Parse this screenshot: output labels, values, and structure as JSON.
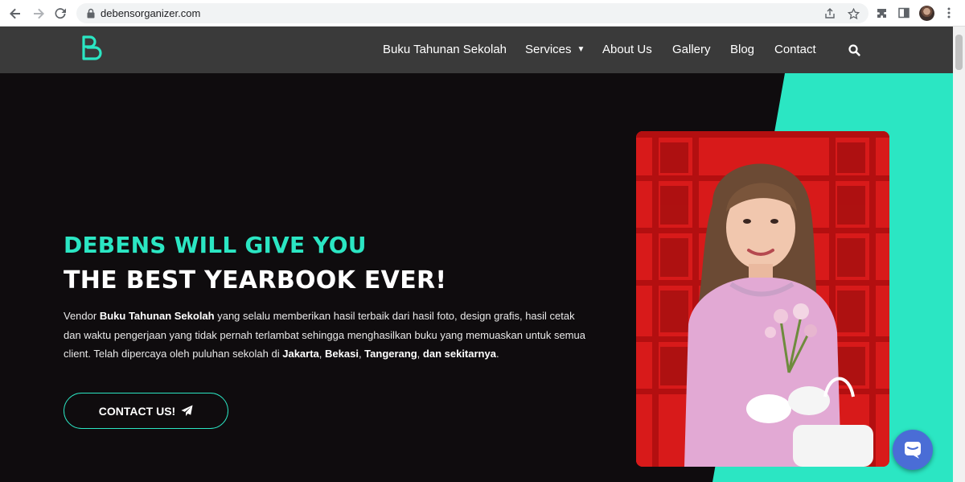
{
  "browser": {
    "url": "debensorganizer.com"
  },
  "header": {
    "nav": [
      {
        "label": "Buku Tahunan Sekolah"
      },
      {
        "label": "Services"
      },
      {
        "label": "About Us"
      },
      {
        "label": "Gallery"
      },
      {
        "label": "Blog"
      },
      {
        "label": "Contact"
      }
    ]
  },
  "hero": {
    "headline_1": "DEBENS WILL GIVE YOU",
    "headline_2": "THE BEST YEARBOOK EVER!",
    "desc": {
      "p1a": "Vendor ",
      "p1b": "Buku Tahunan Sekolah",
      "p1c": " yang selalu memberikan hasil terbaik dari hasil foto, design grafis, hasil cetak dan waktu pengerjaan yang tidak pernah terlambat sehingga menghasilkan buku yang memuaskan untuk semua client. Telah dipercaya oleh puluhan sekolah di ",
      "b1": "Jakarta",
      "s1": ", ",
      "b2": "Bekasi",
      "s2": ", ",
      "b3": "Tangerang",
      "s3": ", ",
      "b4": "dan sekitarnya",
      "end": "."
    },
    "cta_label": "CONTACT US!"
  },
  "colors": {
    "accent": "#2be6c3",
    "header_bg": "#3a3a3a",
    "hero_bg": "#0f0c0e",
    "chat": "#4a6dd6"
  }
}
